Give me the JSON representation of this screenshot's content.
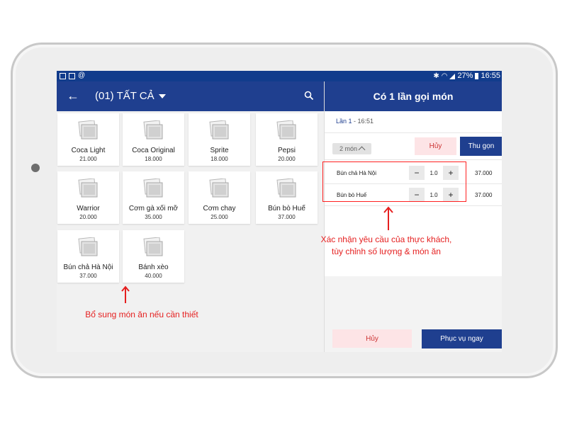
{
  "statusbar": {
    "battery": "27%",
    "time": "16:55",
    "at_symbol": "@"
  },
  "header": {
    "category": "(01) TẤT CẢ",
    "back_icon": "arrow-left-icon",
    "search_icon": "search-icon"
  },
  "order_panel": {
    "title": "Có 1 lần gọi món",
    "round_label": "Lần 1",
    "round_time": " - 16:51",
    "items_count": "2 món",
    "cancel_label": "Hủy",
    "collapse_label": "Thu gọn",
    "items": [
      {
        "name": "Bún chả Hà Nội",
        "qty": "1.0",
        "price": "37.000"
      },
      {
        "name": "Bún bò Huế",
        "qty": "1.0",
        "price": "37.000"
      }
    ],
    "minus_label": "−",
    "plus_label": "+",
    "bottom_cancel_label": "Hủy",
    "serve_label": "Phục vụ ngay"
  },
  "menu_items": [
    {
      "name": "Coca Light",
      "price": "21.000"
    },
    {
      "name": "Coca Original",
      "price": "18.000"
    },
    {
      "name": "Sprite",
      "price": "18.000"
    },
    {
      "name": "Pepsi",
      "price": "20.000"
    },
    {
      "name": "Warrior",
      "price": "20.000"
    },
    {
      "name": "Cơm gà xối mỡ",
      "price": "35.000"
    },
    {
      "name": "Cơm chay",
      "price": "25.000"
    },
    {
      "name": "Bún bò Huế",
      "price": "37.000"
    },
    {
      "name": "Bún chả Hà Nội",
      "price": "37.000"
    },
    {
      "name": "Bánh xèo",
      "price": "40.000"
    }
  ],
  "annotations": {
    "right_line1": "Xác nhận yêu cầu của thực khách,",
    "right_line2": "tùy chỉnh số lượng & món ăn",
    "left": "Bổ sung món ăn nếu cần thiết"
  },
  "colors": {
    "primary": "#1f3f8f",
    "cancel_bg": "#fde4e6",
    "annotation": "#e51f1f"
  }
}
